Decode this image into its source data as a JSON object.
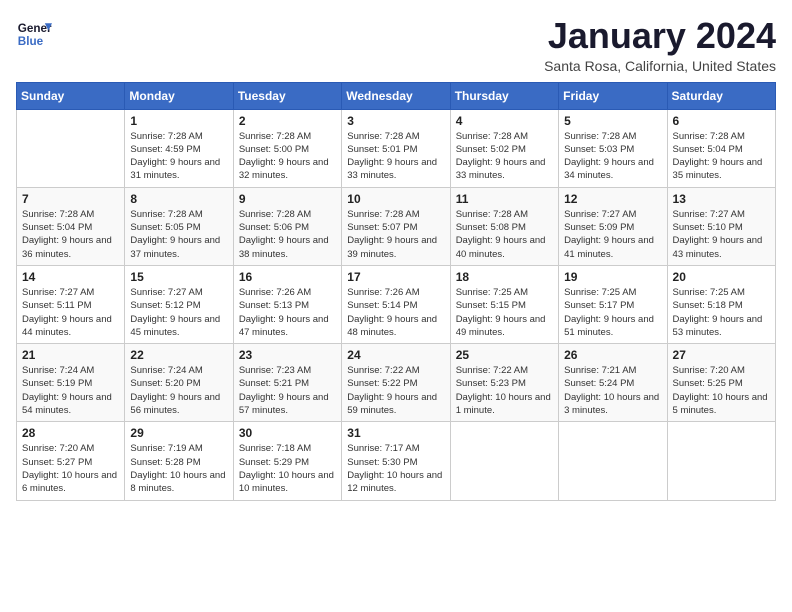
{
  "header": {
    "logo": {
      "line1": "General",
      "line2": "Blue"
    },
    "title": "January 2024",
    "subtitle": "Santa Rosa, California, United States"
  },
  "weekdays": [
    "Sunday",
    "Monday",
    "Tuesday",
    "Wednesday",
    "Thursday",
    "Friday",
    "Saturday"
  ],
  "weeks": [
    [
      {
        "day": "",
        "sunrise": "",
        "sunset": "",
        "daylight": ""
      },
      {
        "day": "1",
        "sunrise": "Sunrise: 7:28 AM",
        "sunset": "Sunset: 4:59 PM",
        "daylight": "Daylight: 9 hours and 31 minutes."
      },
      {
        "day": "2",
        "sunrise": "Sunrise: 7:28 AM",
        "sunset": "Sunset: 5:00 PM",
        "daylight": "Daylight: 9 hours and 32 minutes."
      },
      {
        "day": "3",
        "sunrise": "Sunrise: 7:28 AM",
        "sunset": "Sunset: 5:01 PM",
        "daylight": "Daylight: 9 hours and 33 minutes."
      },
      {
        "day": "4",
        "sunrise": "Sunrise: 7:28 AM",
        "sunset": "Sunset: 5:02 PM",
        "daylight": "Daylight: 9 hours and 33 minutes."
      },
      {
        "day": "5",
        "sunrise": "Sunrise: 7:28 AM",
        "sunset": "Sunset: 5:03 PM",
        "daylight": "Daylight: 9 hours and 34 minutes."
      },
      {
        "day": "6",
        "sunrise": "Sunrise: 7:28 AM",
        "sunset": "Sunset: 5:04 PM",
        "daylight": "Daylight: 9 hours and 35 minutes."
      }
    ],
    [
      {
        "day": "7",
        "sunrise": "Sunrise: 7:28 AM",
        "sunset": "Sunset: 5:04 PM",
        "daylight": "Daylight: 9 hours and 36 minutes."
      },
      {
        "day": "8",
        "sunrise": "Sunrise: 7:28 AM",
        "sunset": "Sunset: 5:05 PM",
        "daylight": "Daylight: 9 hours and 37 minutes."
      },
      {
        "day": "9",
        "sunrise": "Sunrise: 7:28 AM",
        "sunset": "Sunset: 5:06 PM",
        "daylight": "Daylight: 9 hours and 38 minutes."
      },
      {
        "day": "10",
        "sunrise": "Sunrise: 7:28 AM",
        "sunset": "Sunset: 5:07 PM",
        "daylight": "Daylight: 9 hours and 39 minutes."
      },
      {
        "day": "11",
        "sunrise": "Sunrise: 7:28 AM",
        "sunset": "Sunset: 5:08 PM",
        "daylight": "Daylight: 9 hours and 40 minutes."
      },
      {
        "day": "12",
        "sunrise": "Sunrise: 7:27 AM",
        "sunset": "Sunset: 5:09 PM",
        "daylight": "Daylight: 9 hours and 41 minutes."
      },
      {
        "day": "13",
        "sunrise": "Sunrise: 7:27 AM",
        "sunset": "Sunset: 5:10 PM",
        "daylight": "Daylight: 9 hours and 43 minutes."
      }
    ],
    [
      {
        "day": "14",
        "sunrise": "Sunrise: 7:27 AM",
        "sunset": "Sunset: 5:11 PM",
        "daylight": "Daylight: 9 hours and 44 minutes."
      },
      {
        "day": "15",
        "sunrise": "Sunrise: 7:27 AM",
        "sunset": "Sunset: 5:12 PM",
        "daylight": "Daylight: 9 hours and 45 minutes."
      },
      {
        "day": "16",
        "sunrise": "Sunrise: 7:26 AM",
        "sunset": "Sunset: 5:13 PM",
        "daylight": "Daylight: 9 hours and 47 minutes."
      },
      {
        "day": "17",
        "sunrise": "Sunrise: 7:26 AM",
        "sunset": "Sunset: 5:14 PM",
        "daylight": "Daylight: 9 hours and 48 minutes."
      },
      {
        "day": "18",
        "sunrise": "Sunrise: 7:25 AM",
        "sunset": "Sunset: 5:15 PM",
        "daylight": "Daylight: 9 hours and 49 minutes."
      },
      {
        "day": "19",
        "sunrise": "Sunrise: 7:25 AM",
        "sunset": "Sunset: 5:17 PM",
        "daylight": "Daylight: 9 hours and 51 minutes."
      },
      {
        "day": "20",
        "sunrise": "Sunrise: 7:25 AM",
        "sunset": "Sunset: 5:18 PM",
        "daylight": "Daylight: 9 hours and 53 minutes."
      }
    ],
    [
      {
        "day": "21",
        "sunrise": "Sunrise: 7:24 AM",
        "sunset": "Sunset: 5:19 PM",
        "daylight": "Daylight: 9 hours and 54 minutes."
      },
      {
        "day": "22",
        "sunrise": "Sunrise: 7:24 AM",
        "sunset": "Sunset: 5:20 PM",
        "daylight": "Daylight: 9 hours and 56 minutes."
      },
      {
        "day": "23",
        "sunrise": "Sunrise: 7:23 AM",
        "sunset": "Sunset: 5:21 PM",
        "daylight": "Daylight: 9 hours and 57 minutes."
      },
      {
        "day": "24",
        "sunrise": "Sunrise: 7:22 AM",
        "sunset": "Sunset: 5:22 PM",
        "daylight": "Daylight: 9 hours and 59 minutes."
      },
      {
        "day": "25",
        "sunrise": "Sunrise: 7:22 AM",
        "sunset": "Sunset: 5:23 PM",
        "daylight": "Daylight: 10 hours and 1 minute."
      },
      {
        "day": "26",
        "sunrise": "Sunrise: 7:21 AM",
        "sunset": "Sunset: 5:24 PM",
        "daylight": "Daylight: 10 hours and 3 minutes."
      },
      {
        "day": "27",
        "sunrise": "Sunrise: 7:20 AM",
        "sunset": "Sunset: 5:25 PM",
        "daylight": "Daylight: 10 hours and 5 minutes."
      }
    ],
    [
      {
        "day": "28",
        "sunrise": "Sunrise: 7:20 AM",
        "sunset": "Sunset: 5:27 PM",
        "daylight": "Daylight: 10 hours and 6 minutes."
      },
      {
        "day": "29",
        "sunrise": "Sunrise: 7:19 AM",
        "sunset": "Sunset: 5:28 PM",
        "daylight": "Daylight: 10 hours and 8 minutes."
      },
      {
        "day": "30",
        "sunrise": "Sunrise: 7:18 AM",
        "sunset": "Sunset: 5:29 PM",
        "daylight": "Daylight: 10 hours and 10 minutes."
      },
      {
        "day": "31",
        "sunrise": "Sunrise: 7:17 AM",
        "sunset": "Sunset: 5:30 PM",
        "daylight": "Daylight: 10 hours and 12 minutes."
      },
      {
        "day": "",
        "sunrise": "",
        "sunset": "",
        "daylight": ""
      },
      {
        "day": "",
        "sunrise": "",
        "sunset": "",
        "daylight": ""
      },
      {
        "day": "",
        "sunrise": "",
        "sunset": "",
        "daylight": ""
      }
    ]
  ]
}
